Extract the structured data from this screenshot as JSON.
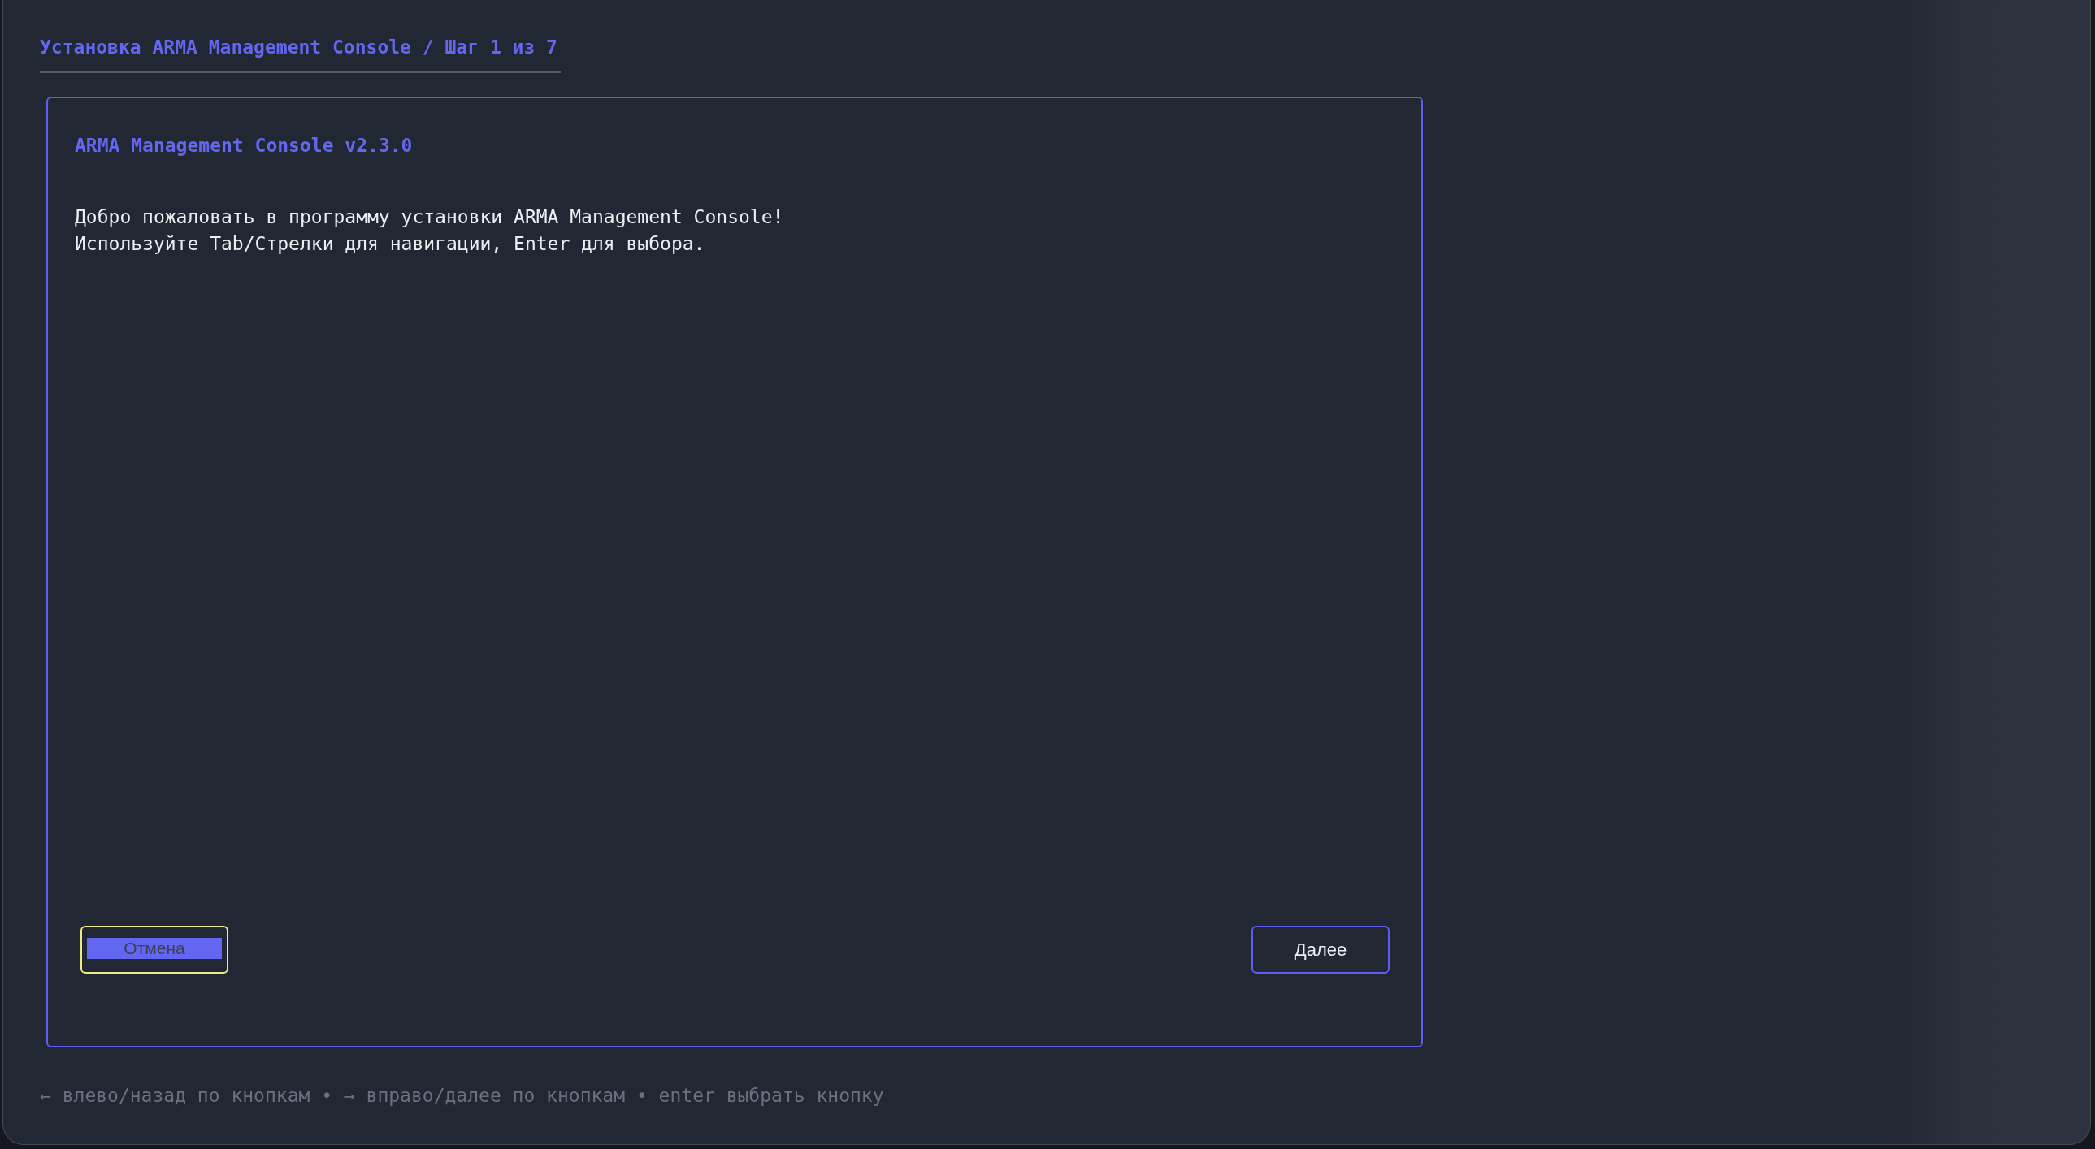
{
  "window": {
    "title": "Установка ARMA Management Console / Шаг 1 из 7"
  },
  "panel": {
    "heading": "ARMA Management Console v2.3.0",
    "message_lines": [
      "Добро пожаловать в программу установки ARMA Management Console!",
      "Используйте Tab/Стрелки для навигации, Enter для выбора."
    ]
  },
  "buttons": [
    {
      "label": "Отмена",
      "selected": true
    },
    {
      "label": "Далее",
      "selected": false
    }
  ],
  "hint_bar": "← влево/назад по кнопкам • → вправо/далее по кнопкам • enter выбрать кнопку"
}
